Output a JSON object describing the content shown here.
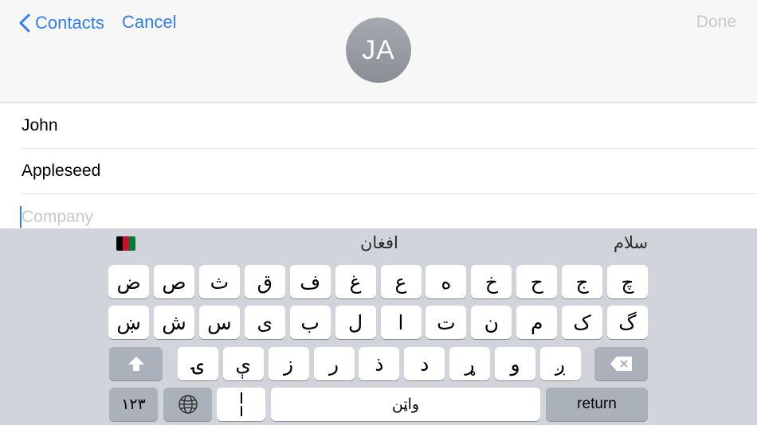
{
  "nav": {
    "back_label": "Contacts",
    "cancel_label": "Cancel",
    "done_label": "Done",
    "avatar_initials": "JA"
  },
  "form": {
    "first_name": "John",
    "last_name": "Appleseed",
    "company_placeholder": "Company"
  },
  "keyboard": {
    "suggestions": [
      "افغان",
      "سلام"
    ],
    "flag_icon": "afghanistan-flag-icon",
    "row1": [
      "چ",
      "ج",
      "ح",
      "خ",
      "ه",
      "ع",
      "غ",
      "ف",
      "ق",
      "ث",
      "ص",
      "ض"
    ],
    "row2": [
      "گ",
      "ک",
      "م",
      "ن",
      "ت",
      "ا",
      "ل",
      "ب",
      "ی",
      "س",
      "ش",
      "ښ"
    ],
    "row3": [
      "ږ",
      "و",
      "ړ",
      "د",
      "ذ",
      "ر",
      "ز",
      "ې",
      "ۍ"
    ],
    "numbers_label": "۱۲۳",
    "space_label": "واټن",
    "return_label": "return"
  },
  "colors": {
    "accent": "#2f7cf6",
    "keyboard_bg": "#d1d4da",
    "dark_key": "#abb1ba"
  }
}
